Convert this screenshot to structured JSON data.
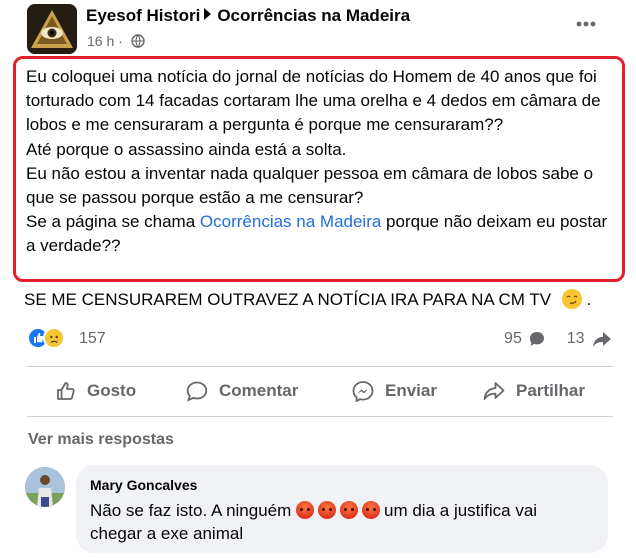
{
  "post": {
    "author": "Eyesof Histori",
    "group": "Ocorrências na Madeira",
    "time": "16 h ·",
    "text_lines": [
      "Eu coloquei uma notícia do jornal de notícias do Homem de 40 anos que foi torturado com 14 facadas cortaram lhe uma orelha e 4 dedos em câmara de lobos e me censuraram a pergunta é porque me censuraram??",
      "Até porque o assassino ainda está a solta.",
      "Eu não estou a inventar nada qualquer pessoa em câmara de lobos sabe o que se passou porque estão a me censurar?"
    ],
    "last_line_before": "Se a página se chama ",
    "last_line_link": "Ocorrências na Madeira",
    "last_line_after": " porque não deixam eu postar a verdade??",
    "after_box": "SE ME CENSURAREM OUTRAVEZ A NOTÍCIA IRA PARA NA CM TV",
    "after_box_tail": " ."
  },
  "stats": {
    "reaction_count": "157",
    "comments": "95",
    "shares": "13"
  },
  "actions": {
    "like": "Gosto",
    "comment": "Comentar",
    "send": "Enviar",
    "share": "Partilhar"
  },
  "more_replies": "Ver mais respostas",
  "comment": {
    "name": "Mary Goncalves",
    "text_before": "Não se faz isto. A ninguém ",
    "text_after": "um dia a justifica vai chegar a exe animal"
  },
  "colors": {
    "highlight_border": "#e41f2c",
    "link": "#216fdb",
    "like_blue": "#1877f2"
  }
}
